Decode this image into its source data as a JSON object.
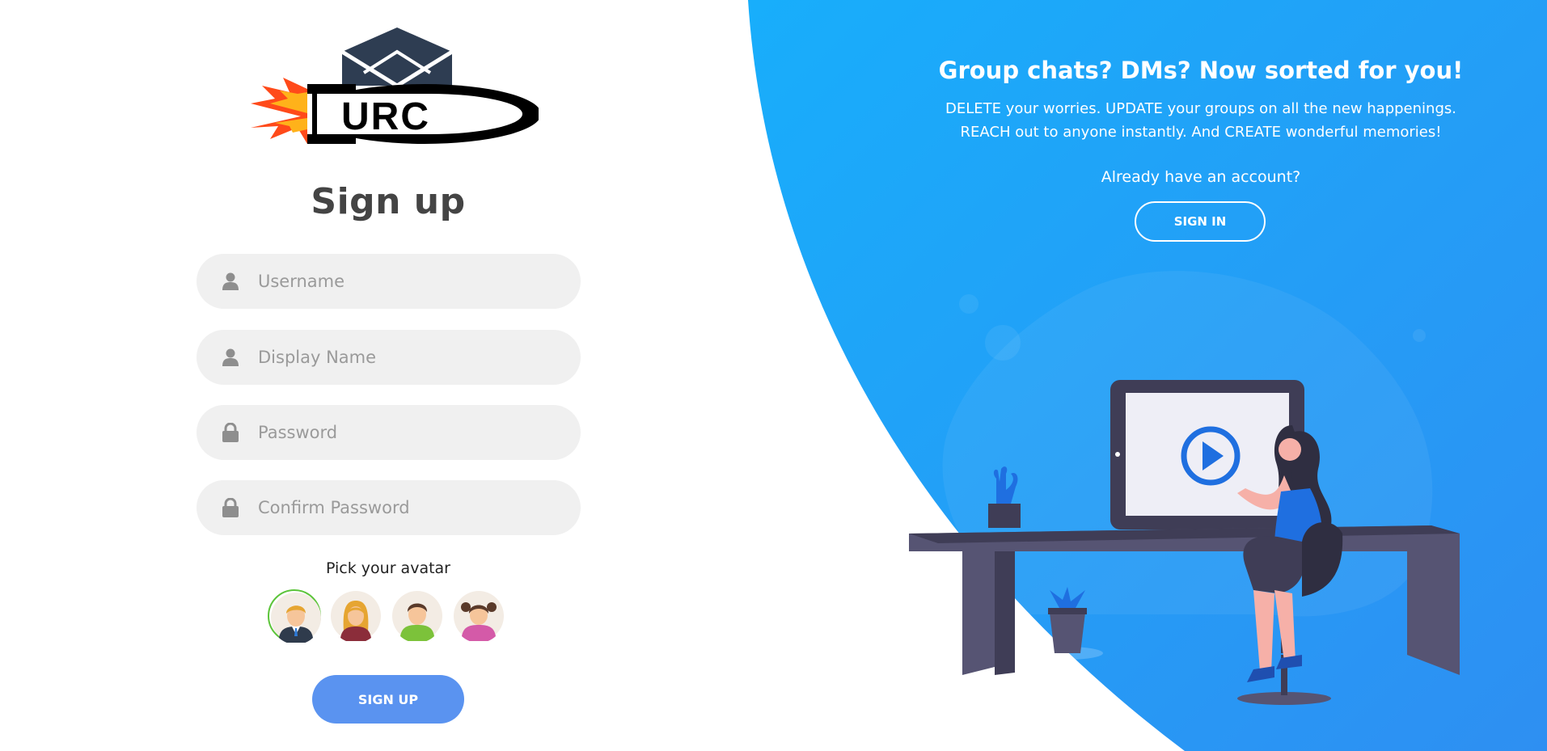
{
  "logo": {
    "text": "URC"
  },
  "signup_form": {
    "title": "Sign up",
    "fields": [
      {
        "placeholder": "Username",
        "icon": "user-icon"
      },
      {
        "placeholder": "Display Name",
        "icon": "user-icon"
      },
      {
        "placeholder": "Password",
        "icon": "lock-icon"
      },
      {
        "placeholder": "Confirm Password",
        "icon": "lock-icon"
      }
    ],
    "avatar_label": "Pick your avatar",
    "avatars": [
      "man-avatar",
      "woman-avatar",
      "boy-avatar",
      "girl-avatar"
    ],
    "selected_avatar": "man-avatar",
    "submit_label": "SIGN UP"
  },
  "promo": {
    "headline": "Group chats? DMs? Now sorted for you!",
    "line1": "DELETE your worries. UPDATE your groups on all the new happenings.",
    "line2": "REACH out to anyone instantly. And CREATE wonderful memories!",
    "already_text": "Already have an account?",
    "signin_label": "SIGN IN"
  },
  "colors": {
    "accent_blue": "#1aa7fb",
    "button_blue": "#5a93f0",
    "selected_ring": "#5cc43a",
    "field_bg": "#f0f0f0"
  }
}
